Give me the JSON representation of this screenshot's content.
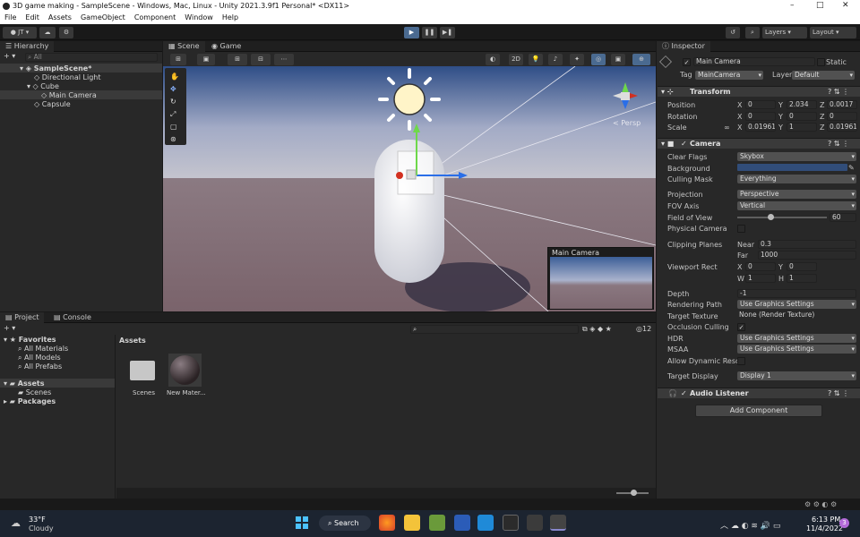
{
  "window": {
    "title": "3D game making - SampleScene - Windows, Mac, Linux - Unity 2021.3.9f1 Personal* <DX11>"
  },
  "menu": [
    "File",
    "Edit",
    "Assets",
    "GameObject",
    "Component",
    "Window",
    "Help"
  ],
  "toolbar": {
    "account": "JT",
    "layers": "Layers",
    "layout": "Layout"
  },
  "hierarchy": {
    "tab": "Hierarchy",
    "search_placeholder": "All",
    "scene": "SampleScene*",
    "items": [
      "Directional Light",
      "Cube",
      "Main Camera",
      "Capsule"
    ]
  },
  "scene_tabs": [
    "Scene",
    "Game"
  ],
  "scene_toolbar": {
    "mode_2d": "2D",
    "persp_label": "< Persp"
  },
  "preview": {
    "title": "Main Camera"
  },
  "project": {
    "tabs": [
      "Project",
      "Console"
    ],
    "count": "12",
    "favorites": {
      "title": "Favorites",
      "items": [
        "All Materials",
        "All Models",
        "All Prefabs"
      ]
    },
    "assets_tree": {
      "title": "Assets",
      "children": [
        "Scenes"
      ]
    },
    "packages": "Packages",
    "breadcrumb": "Assets",
    "assets": [
      "Scenes",
      "New Mater..."
    ]
  },
  "inspector": {
    "tab": "Inspector",
    "name": "Main Camera",
    "static": "Static",
    "tag_label": "Tag",
    "tag": "MainCamera",
    "layer_label": "Layer",
    "layer": "Default",
    "transform": {
      "title": "Transform",
      "rows": [
        {
          "label": "Position",
          "x": "0",
          "y": "2.034",
          "z": "0.0017"
        },
        {
          "label": "Rotation",
          "x": "0",
          "y": "0",
          "z": "0"
        },
        {
          "label": "Scale",
          "x": "0.01961",
          "y": "1",
          "z": "0.01961"
        }
      ]
    },
    "camera": {
      "title": "Camera",
      "clear_flags_label": "Clear Flags",
      "clear_flags": "Skybox",
      "background_label": "Background",
      "background_color": "#314D79",
      "culling_label": "Culling Mask",
      "culling": "Everything",
      "projection_label": "Projection",
      "projection": "Perspective",
      "fov_axis_label": "FOV Axis",
      "fov_axis": "Vertical",
      "fov_label": "Field of View",
      "fov": "60",
      "fov_fraction": 0.25,
      "physical_label": "Physical Camera",
      "clipping_label": "Clipping Planes",
      "near_label": "Near",
      "near": "0.3",
      "far_label": "Far",
      "far": "1000",
      "viewport_label": "Viewport Rect",
      "vx": "0",
      "vy": "0",
      "vw": "1",
      "vh": "1",
      "depth_label": "Depth",
      "depth": "-1",
      "render_path_label": "Rendering Path",
      "render_path": "Use Graphics Settings",
      "target_texture_label": "Target Texture",
      "target_texture": "None (Render Texture)",
      "occlusion_label": "Occlusion Culling",
      "hdr_label": "HDR",
      "hdr": "Use Graphics Settings",
      "msaa_label": "MSAA",
      "msaa": "Use Graphics Settings",
      "dyn_res_label": "Allow Dynamic Resol",
      "display_label": "Target Display",
      "display": "Display 1"
    },
    "audio": {
      "title": "Audio Listener"
    },
    "add_component": "Add Component"
  },
  "taskbar": {
    "temp": "33°F",
    "weather": "Cloudy",
    "search": "Search",
    "time": "6:13 PM",
    "date": "11/4/2022",
    "badge": "3"
  }
}
